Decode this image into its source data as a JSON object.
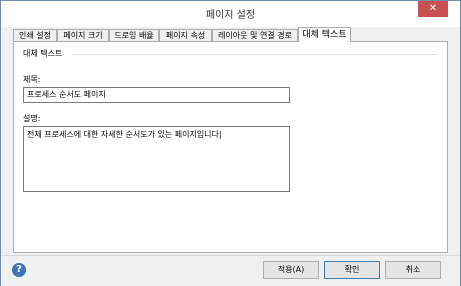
{
  "window": {
    "title": "페이지 설정",
    "close_symbol": "✕"
  },
  "tabs": [
    {
      "label": "인쇄 설정"
    },
    {
      "label": "페이지 크기"
    },
    {
      "label": "드로잉 배율"
    },
    {
      "label": "페이지 속성"
    },
    {
      "label": "레이아웃 및 연결 경로"
    },
    {
      "label": "대체 텍스트",
      "active": true
    }
  ],
  "alt_text": {
    "group_label": "대체 텍스트",
    "title_label": "제목:",
    "title_value": "프로세스 순서도 페이지",
    "desc_label": "설명:",
    "desc_value": "전체 프로세스에 대한 자세한 순서도가 있는 페이지입니다|"
  },
  "footer": {
    "help_icon": "question-icon",
    "help_symbol": "?",
    "apply_label": "적용(A)",
    "ok_label": "확인",
    "cancel_label": "취소"
  }
}
